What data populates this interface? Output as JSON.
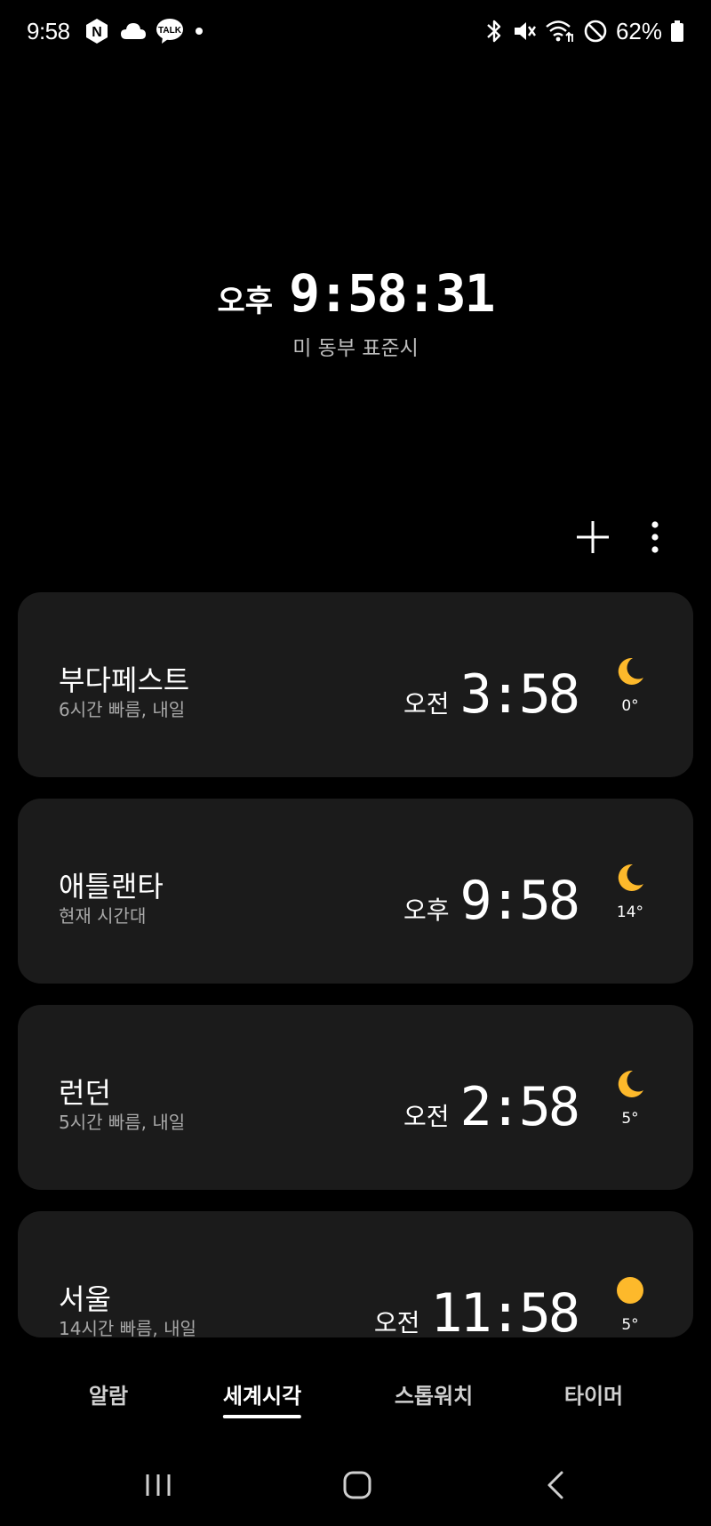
{
  "status_bar": {
    "time": "9:58",
    "battery": "62%",
    "kakao_label": "TALK",
    "naver_label": "N"
  },
  "main_clock": {
    "ampm": "오후",
    "time": "9:58:31",
    "timezone": "미 동부 표준시"
  },
  "cities": [
    {
      "name": "부다페스트",
      "diff": "6시간 빠름, 내일",
      "ampm": "오전",
      "time": "3:58",
      "weather": "moon",
      "temp": "0°"
    },
    {
      "name": "애틀랜타",
      "diff": "현재 시간대",
      "ampm": "오후",
      "time": "9:58",
      "weather": "moon",
      "temp": "14°"
    },
    {
      "name": "런던",
      "diff": "5시간 빠름, 내일",
      "ampm": "오전",
      "time": "2:58",
      "weather": "moon",
      "temp": "5°"
    },
    {
      "name": "서울",
      "diff": "14시간 빠름, 내일",
      "ampm": "오전",
      "time": "11:58",
      "weather": "sun",
      "temp": "5°"
    }
  ],
  "tabs": [
    {
      "label": "알람",
      "active": false
    },
    {
      "label": "세계시각",
      "active": true
    },
    {
      "label": "스톱워치",
      "active": false
    },
    {
      "label": "타이머",
      "active": false
    }
  ],
  "colors": {
    "background": "#000000",
    "card": "#1b1b1b",
    "weather_accent": "#fdb92b"
  }
}
